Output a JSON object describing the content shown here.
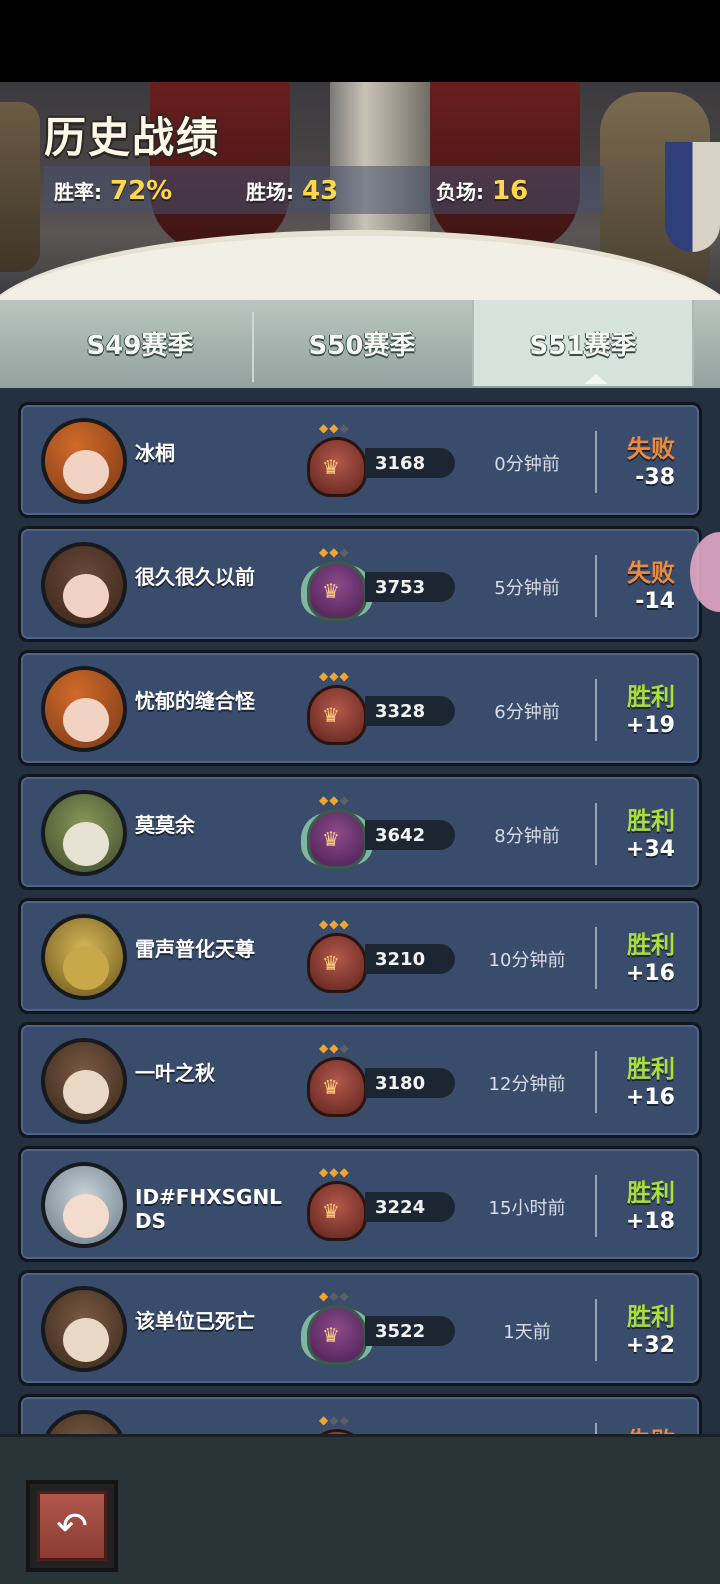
{
  "header": {
    "title": "历史战绩",
    "stats": {
      "win_rate_label": "胜率:",
      "win_rate_value": "72%",
      "wins_label": "胜场:",
      "wins_value": "43",
      "losses_label": "负场:",
      "losses_value": "16"
    }
  },
  "tabs": [
    {
      "label": "S49赛季",
      "active": false
    },
    {
      "label": "S50赛季",
      "active": false
    },
    {
      "label": "S51赛季",
      "active": true
    }
  ],
  "matches": [
    {
      "name": "冰桐",
      "avatar": "pumpkin-avatar",
      "stars": [
        1,
        1,
        0
      ],
      "score": "3168",
      "time": "0分钟前",
      "result": "失败",
      "delta": "-38",
      "outcome": "lose"
    },
    {
      "name": "很久很久以前",
      "avatar": "girl-avatar",
      "stars": [
        1,
        1,
        0
      ],
      "score": "3753",
      "time": "5分钟前",
      "result": "失败",
      "delta": "-14",
      "outcome": "lose"
    },
    {
      "name": "忧郁的缝合怪",
      "avatar": "pumpkin-avatar",
      "stars": [
        1,
        1,
        1
      ],
      "score": "3328",
      "time": "6分钟前",
      "result": "胜利",
      "delta": "+19",
      "outcome": "win"
    },
    {
      "name": "莫莫余",
      "avatar": "raccoon-avatar",
      "stars": [
        1,
        1,
        0
      ],
      "score": "3642",
      "time": "8分钟前",
      "result": "胜利",
      "delta": "+34",
      "outcome": "win"
    },
    {
      "name": "雷声普化天尊",
      "avatar": "golden-avatar",
      "stars": [
        1,
        1,
        1
      ],
      "score": "3210",
      "time": "10分钟前",
      "result": "胜利",
      "delta": "+16",
      "outcome": "win"
    },
    {
      "name": "一叶之秋",
      "avatar": "monkey-avatar",
      "stars": [
        1,
        1,
        0
      ],
      "score": "3180",
      "time": "12分钟前",
      "result": "胜利",
      "delta": "+16",
      "outcome": "win"
    },
    {
      "name": "ID#FHXSGNLDS",
      "avatar": "silver-hair-avatar",
      "stars": [
        1,
        1,
        1
      ],
      "score": "3224",
      "time": "15小时前",
      "result": "胜利",
      "delta": "+18",
      "outcome": "win"
    },
    {
      "name": "该单位已死亡",
      "avatar": "monkey-avatar",
      "stars": [
        1,
        0,
        0
      ],
      "score": "3522",
      "time": "1天前",
      "result": "胜利",
      "delta": "+32",
      "outcome": "win"
    },
    {
      "name": "",
      "avatar": "monkey-avatar",
      "stars": [
        1,
        0,
        0
      ],
      "score": "",
      "time": "",
      "result": "失败",
      "delta": "",
      "outcome": "lose"
    }
  ],
  "icons": {
    "back": "back-arrow-icon",
    "rank": "rank-emblem-icon"
  },
  "colors": {
    "win": "#a8e03a",
    "lose": "#f08a3a",
    "stat_value": "#ffd84a",
    "row_bg": "#3a4c6c"
  }
}
